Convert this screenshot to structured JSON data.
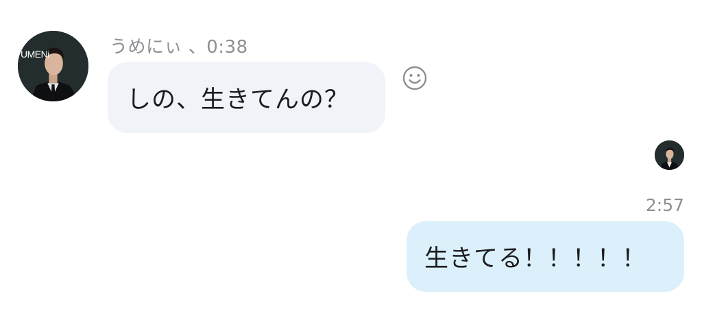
{
  "incoming": {
    "sender_name": "うめにぃ",
    "separator": "、",
    "time": "0:38",
    "meta_text": "うめにぃ 、0:38",
    "message": "しの、生きてんの？",
    "avatar_logo": "UMENi"
  },
  "outgoing": {
    "time": "2:57",
    "message": "生きてる！！！！！"
  },
  "icons": {
    "reaction": "smiley-face-icon",
    "read_receipt": "read-receipt-avatar"
  },
  "colors": {
    "incoming_bubble": "#f0f3f7",
    "outgoing_bubble": "#dcf0fb",
    "meta_text": "#8e8e93",
    "text": "#1c1c1e"
  }
}
